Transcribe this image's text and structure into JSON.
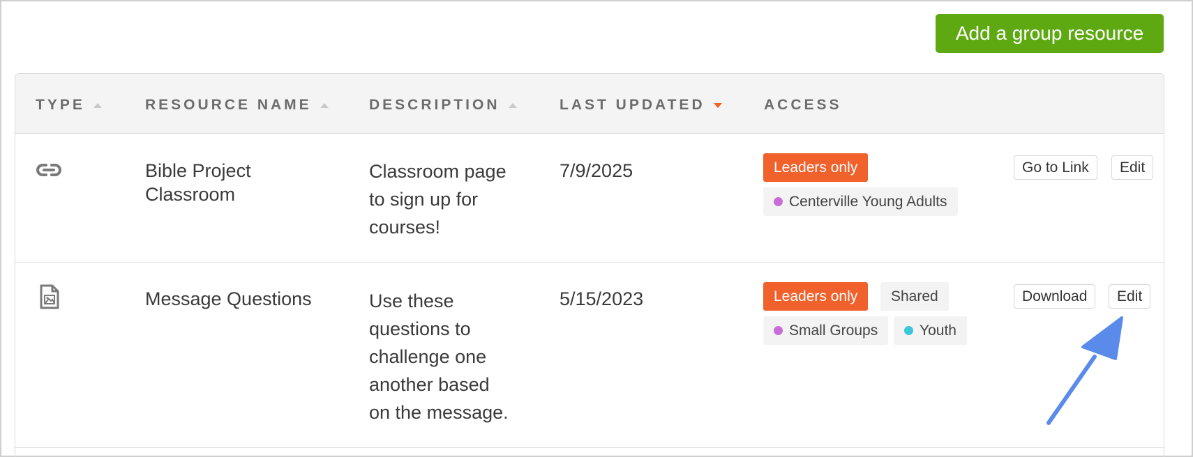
{
  "toolbar": {
    "add_label": "Add a group resource"
  },
  "table": {
    "headers": {
      "type": "TYPE",
      "name": "RESOURCE NAME",
      "description": "DESCRIPTION",
      "updated": "LAST UPDATED",
      "access": "ACCESS"
    },
    "sort": {
      "column": "LAST UPDATED",
      "direction": "descending"
    },
    "rows": [
      {
        "type_icon": "link-icon",
        "name_line1": "Bible Project",
        "name_line2": "Classroom",
        "desc_lines": [
          "Classroom page",
          "to sign up for",
          "courses!"
        ],
        "updated": "7/9/2025",
        "access_badges": [
          "Leaders only"
        ],
        "groups": [
          {
            "name": "Centerville Young Adults",
            "color": "#c86dd7"
          }
        ],
        "actions": [
          "Go to Link",
          "Edit"
        ]
      },
      {
        "type_icon": "image-file-icon",
        "name_line1": "Message Questions",
        "desc_lines": [
          "Use these",
          "questions to",
          "challenge one",
          "another based",
          "on the message."
        ],
        "updated": "5/15/2023",
        "access_badges": [
          "Leaders only",
          "Shared"
        ],
        "groups": [
          {
            "name": "Small Groups",
            "color": "#c86dd7"
          },
          {
            "name": "Youth",
            "color": "#3cc6d9"
          }
        ],
        "actions": [
          "Download",
          "Edit"
        ]
      }
    ]
  },
  "colors": {
    "accent_green": "#5ea912",
    "leaders_orange": "#f0612c",
    "annotation_arrow": "#5a8bea"
  }
}
